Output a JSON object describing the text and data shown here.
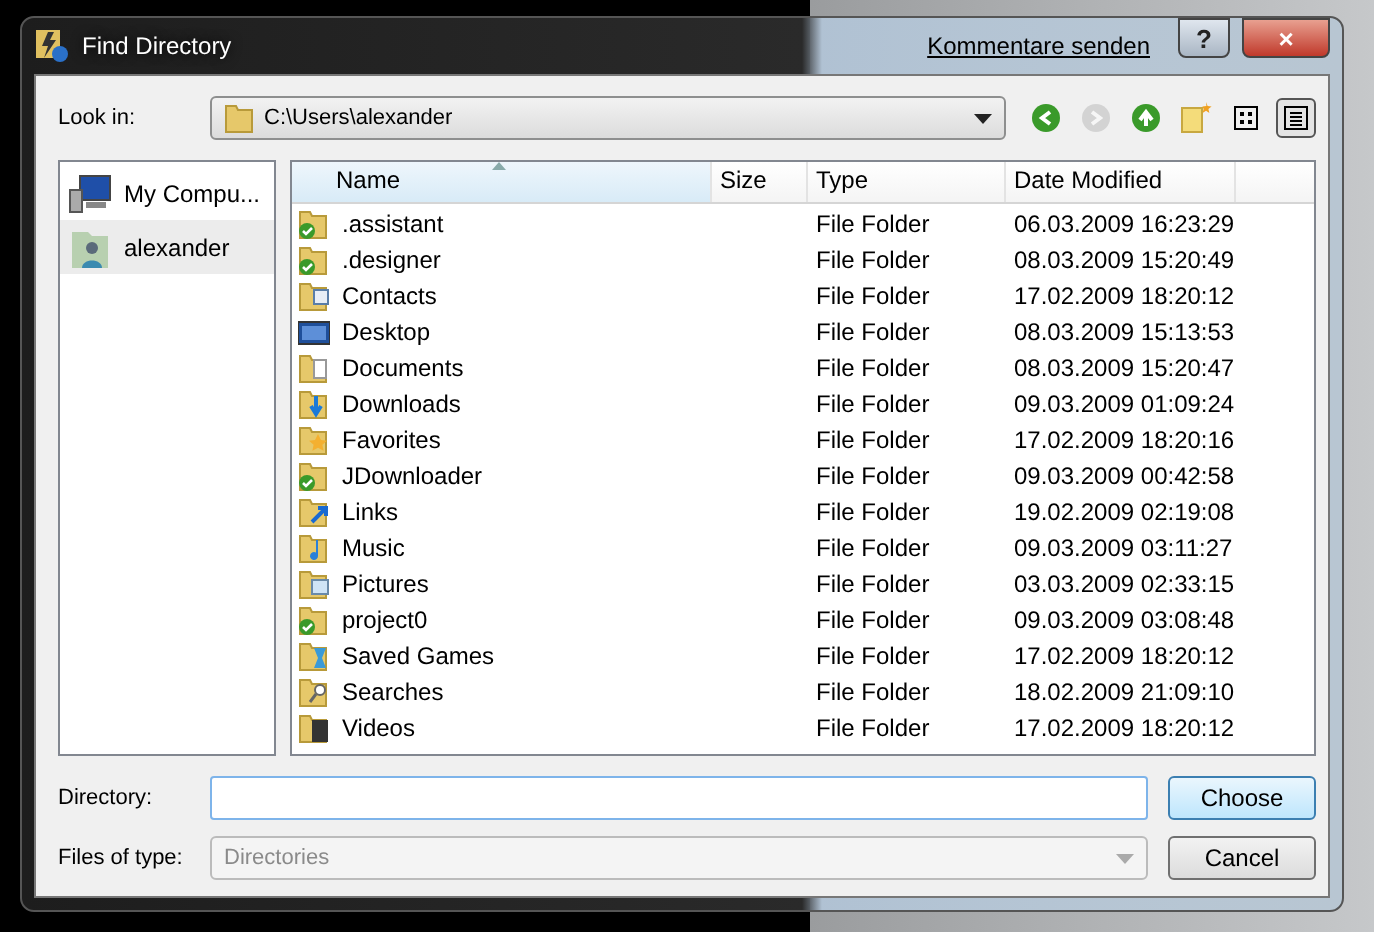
{
  "window": {
    "title": "Find Directory",
    "feedback_link": "Kommentare senden",
    "help_button": "?",
    "close_button": "×"
  },
  "look_in": {
    "label": "Look in:",
    "value": "C:\\Users\\alexander"
  },
  "toolbar": [
    {
      "kind": "back",
      "disabled": false
    },
    {
      "kind": "forward",
      "disabled": true
    },
    {
      "kind": "up",
      "disabled": false
    },
    {
      "kind": "new-folder",
      "disabled": false
    },
    {
      "kind": "list-view",
      "selected": false
    },
    {
      "kind": "details-view",
      "selected": true
    }
  ],
  "sidebar": {
    "items": [
      {
        "label": "My Compu...",
        "kind": "computer",
        "selected": false
      },
      {
        "label": "alexander",
        "kind": "user",
        "selected": true
      }
    ]
  },
  "table": {
    "columns": [
      {
        "label": "Name",
        "sorted": true
      },
      {
        "label": "Size",
        "sorted": false
      },
      {
        "label": "Type",
        "sorted": false
      },
      {
        "label": "Date Modified",
        "sorted": false
      }
    ],
    "rows": [
      {
        "name": ".assistant",
        "kind": "synced",
        "type": "File Folder",
        "modified": "06.03.2009 16:23:29"
      },
      {
        "name": ".designer",
        "kind": "synced",
        "type": "File Folder",
        "modified": "08.03.2009 15:20:49"
      },
      {
        "name": "Contacts",
        "kind": "contacts",
        "type": "File Folder",
        "modified": "17.02.2009 18:20:12"
      },
      {
        "name": "Desktop",
        "kind": "desktop",
        "type": "File Folder",
        "modified": "08.03.2009 15:13:53"
      },
      {
        "name": "Documents",
        "kind": "documents",
        "type": "File Folder",
        "modified": "08.03.2009 15:20:47"
      },
      {
        "name": "Downloads",
        "kind": "downloads",
        "type": "File Folder",
        "modified": "09.03.2009 01:09:24"
      },
      {
        "name": "Favorites",
        "kind": "favorites",
        "type": "File Folder",
        "modified": "17.02.2009 18:20:16"
      },
      {
        "name": "JDownloader",
        "kind": "synced",
        "type": "File Folder",
        "modified": "09.03.2009 00:42:58"
      },
      {
        "name": "Links",
        "kind": "links",
        "type": "File Folder",
        "modified": "19.02.2009 02:19:08"
      },
      {
        "name": "Music",
        "kind": "music",
        "type": "File Folder",
        "modified": "09.03.2009 03:11:27"
      },
      {
        "name": "Pictures",
        "kind": "pictures",
        "type": "File Folder",
        "modified": "03.03.2009 02:33:15"
      },
      {
        "name": "project0",
        "kind": "synced",
        "type": "File Folder",
        "modified": "09.03.2009 03:08:48"
      },
      {
        "name": "Saved Games",
        "kind": "games",
        "type": "File Folder",
        "modified": "17.02.2009 18:20:12"
      },
      {
        "name": "Searches",
        "kind": "searches",
        "type": "File Folder",
        "modified": "18.02.2009 21:09:10"
      },
      {
        "name": "Videos",
        "kind": "videos",
        "type": "File Folder",
        "modified": "17.02.2009 18:20:12"
      }
    ]
  },
  "directory": {
    "label": "Directory:"
  },
  "files_of_type": {
    "label": "Files of type:",
    "value": "Directories",
    "disabled": true
  },
  "buttons": [
    {
      "label": "Choose",
      "default": true
    },
    {
      "label": "Cancel",
      "default": false
    }
  ]
}
